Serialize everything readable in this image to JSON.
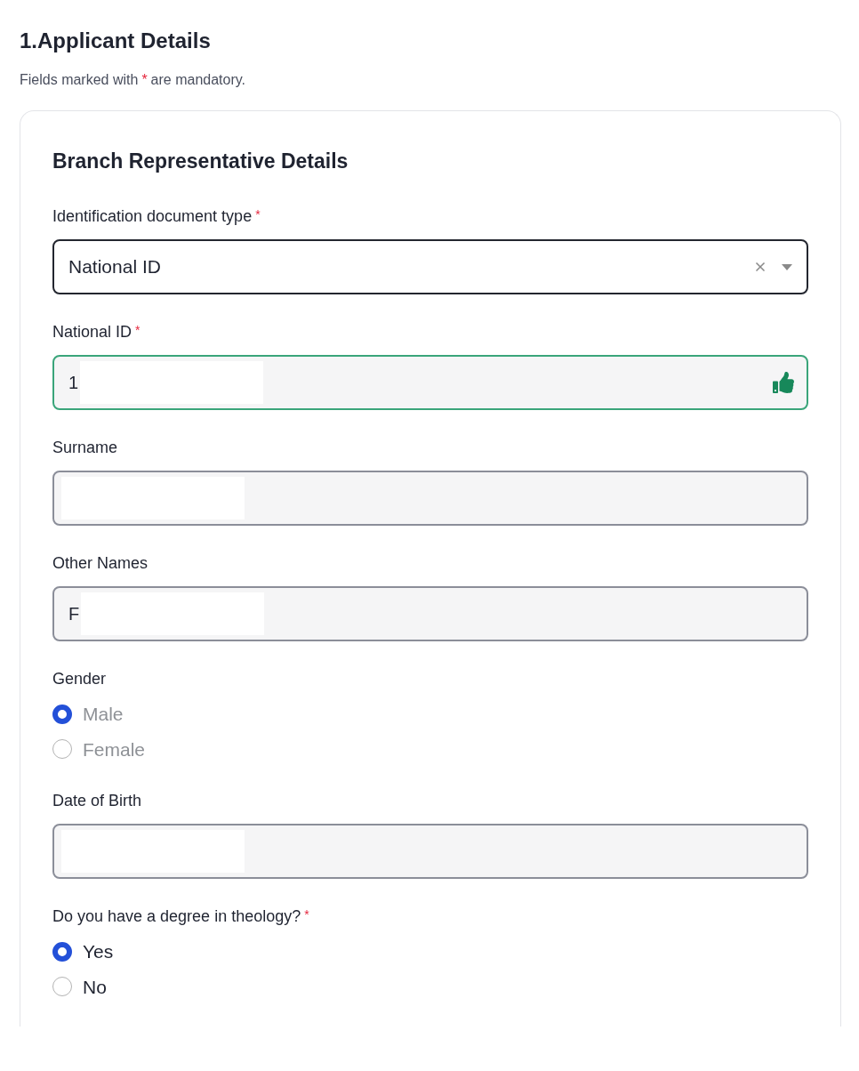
{
  "section": {
    "title": "1.Applicant Details",
    "note_before": "Fields marked with",
    "required_mark": "*",
    "note_after": "are mandatory."
  },
  "card": {
    "title": "Branch Representative Details",
    "fields": [
      {
        "kind": "select",
        "label": "Identification document type",
        "required": true,
        "value": "National ID"
      },
      {
        "kind": "text",
        "label": "National ID",
        "required": true,
        "value": "1",
        "valid": true
      },
      {
        "kind": "text",
        "label": "Surname",
        "required": false,
        "valid": false
      },
      {
        "kind": "text",
        "label": "Other Names",
        "required": false,
        "value": "F",
        "valid": false
      },
      {
        "kind": "radio",
        "label": "Gender",
        "required": false,
        "disabled": true,
        "options": [
          {
            "label": "Male",
            "selected": true
          },
          {
            "label": "Female",
            "selected": false
          }
        ]
      },
      {
        "kind": "text",
        "label": "Date of Birth",
        "required": false,
        "valid": false
      },
      {
        "kind": "radio",
        "label": "Do you have a degree in theology?",
        "required": true,
        "disabled": false,
        "options": [
          {
            "label": "Yes",
            "selected": true
          },
          {
            "label": "No",
            "selected": false
          }
        ]
      }
    ]
  }
}
